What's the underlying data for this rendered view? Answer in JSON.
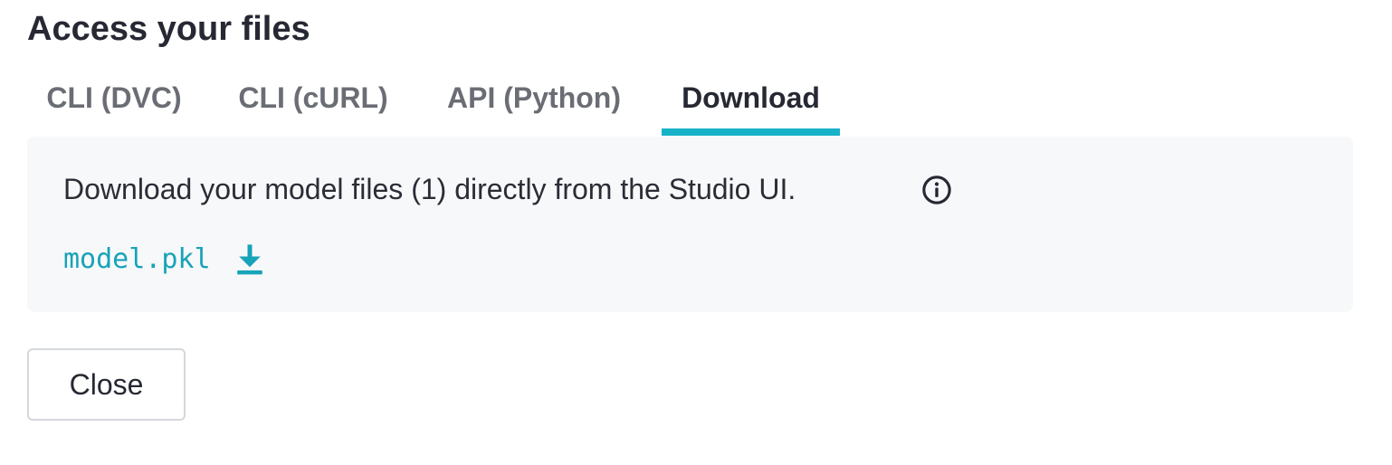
{
  "dialog": {
    "title": "Access your files"
  },
  "tabs": [
    {
      "label": "CLI (DVC)",
      "active": false
    },
    {
      "label": "CLI (cURL)",
      "active": false
    },
    {
      "label": "API (Python)",
      "active": false
    },
    {
      "label": "Download",
      "active": true
    }
  ],
  "panel": {
    "description": "Download your model files (1) directly from the Studio UI.",
    "info_icon": "info-circle-icon",
    "files": [
      {
        "name": "model.pkl",
        "icon": "download-icon"
      }
    ]
  },
  "footer": {
    "close_label": "Close"
  },
  "colors": {
    "accent": "#17b2c8",
    "link": "#17a3b8",
    "panel_bg": "#f7f8fa",
    "text_primary": "#262833",
    "text_muted": "#6b6d75"
  }
}
